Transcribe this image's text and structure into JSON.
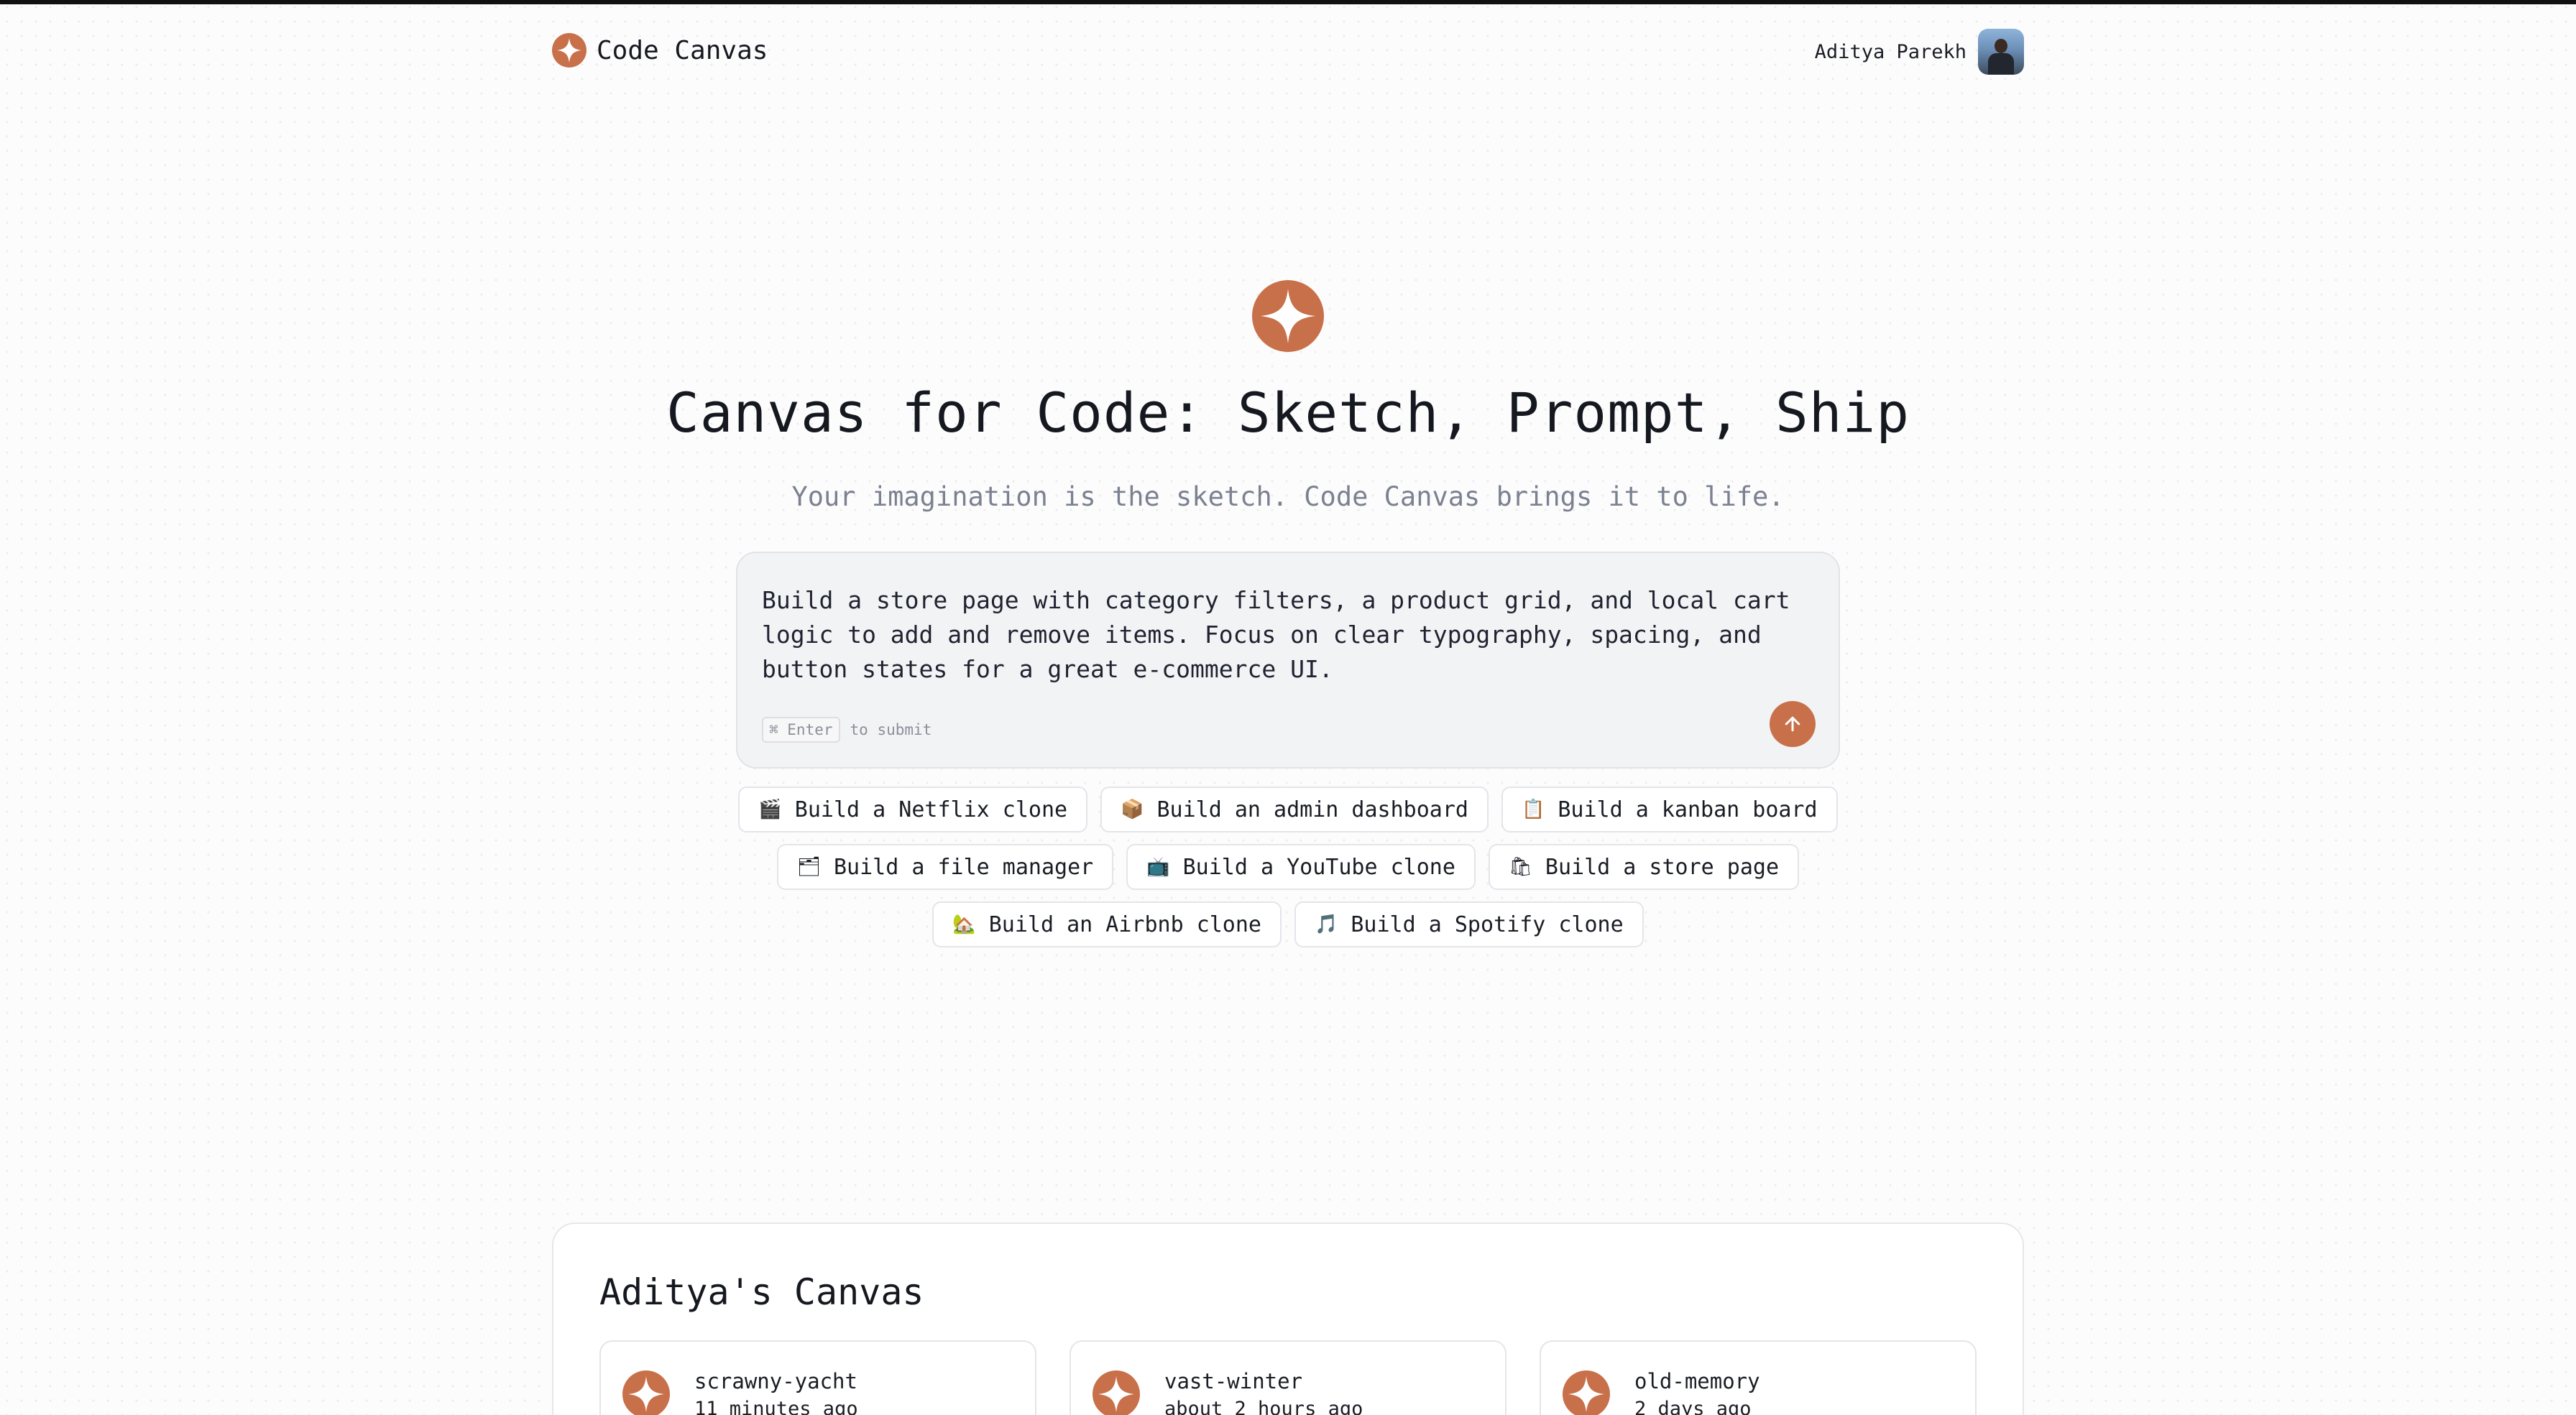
{
  "brand": {
    "name": "Code Canvas",
    "logo_icon": "sparkle-logo-icon",
    "accent": "#c8704a"
  },
  "user": {
    "name": "Aditya Parekh",
    "avatar_icon": "user-avatar"
  },
  "hero": {
    "title": "Canvas for Code: Sketch, Prompt, Ship",
    "subtitle": "Your imagination is the sketch. Code Canvas brings it to life."
  },
  "prompt": {
    "value": "Build a store page with category filters, a product grid, and local cart\nlogic to add and remove items. Focus on clear typography, spacing, and\nbutton states for a great e-commerce UI.",
    "kbd_key": "⌘ Enter",
    "kbd_suffix": "to submit",
    "submit_icon": "arrow-up-icon"
  },
  "suggestions": [
    {
      "emoji": "🎬",
      "label": "Build a Netflix clone"
    },
    {
      "emoji": "📦",
      "label": "Build an admin dashboard"
    },
    {
      "emoji": "📋",
      "label": "Build a kanban board"
    },
    {
      "emoji": "🗂",
      "label": "Build a file manager"
    },
    {
      "emoji": "📺",
      "label": "Build a YouTube clone"
    },
    {
      "emoji": "🛍",
      "label": "Build a store page"
    },
    {
      "emoji": "🏡",
      "label": "Build an Airbnb clone"
    },
    {
      "emoji": "🎵",
      "label": "Build a Spotify clone"
    }
  ],
  "canvas": {
    "title": "Aditya's Canvas",
    "projects": [
      {
        "name": "scrawny-yacht",
        "time": "11 minutes ago"
      },
      {
        "name": "vast-winter",
        "time": "about 2 hours ago"
      },
      {
        "name": "old-memory",
        "time": "2 days ago"
      }
    ]
  }
}
